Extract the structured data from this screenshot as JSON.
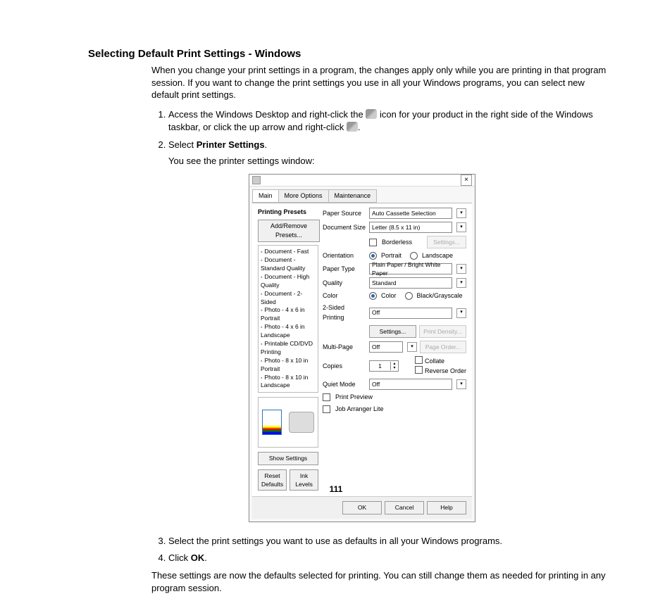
{
  "title": "Selecting Default Print Settings - Windows",
  "intro": "When you change your print settings in a program, the changes apply only while you are printing in that program session. If you want to change the print settings you use in all your Windows programs, you can select new default print settings.",
  "steps": {
    "s1a": "Access the Windows Desktop and right-click the ",
    "s1b": " icon for your product in the right side of the Windows taskbar, or click the up arrow and right-click ",
    "s1c": ".",
    "s2a": "Select ",
    "s2b": "Printer Settings",
    "s2c": ".",
    "s2_sub": "You see the printer settings window:",
    "s3": "Select the print settings you want to use as defaults in all your Windows programs.",
    "s4a": "Click ",
    "s4b": "OK",
    "s4c": "."
  },
  "closing": "These settings are now the defaults selected for printing. You can still change them as needed for printing in any program session.",
  "page_number": "111",
  "dialog": {
    "tabs": {
      "main": "Main",
      "more": "More Options",
      "maint": "Maintenance"
    },
    "presets_header": "Printing Presets",
    "add_remove": "Add/Remove Presets...",
    "presets": [
      "Document - Fast",
      "Document - Standard Quality",
      "Document - High Quality",
      "Document - 2-Sided",
      "Photo - 4 x 6 in Portrait",
      "Photo - 4 x 6 in Landscape",
      "Printable CD/DVD Printing",
      "Photo - 8 x 10 in Portrait",
      "Photo - 8 x 10 in Landscape"
    ],
    "show_settings": "Show Settings",
    "reset_defaults": "Reset Defaults",
    "ink_levels": "Ink Levels",
    "labels": {
      "paper_source": "Paper Source",
      "document_size": "Document Size",
      "borderless": "Borderless",
      "settings": "Settings...",
      "orientation": "Orientation",
      "portrait": "Portrait",
      "landscape": "Landscape",
      "paper_type": "Paper Type",
      "quality": "Quality",
      "color": "Color",
      "color_opt": "Color",
      "bw_opt": "Black/Grayscale",
      "two_sided": "2-Sided Printing",
      "print_density": "Print Density...",
      "multi_page": "Multi-Page",
      "page_order": "Page Order...",
      "copies": "Copies",
      "collate": "Collate",
      "reverse": "Reverse Order",
      "quiet": "Quiet Mode",
      "print_preview": "Print Preview",
      "job_arranger": "Job Arranger Lite"
    },
    "values": {
      "paper_source": "Auto Cassette Selection",
      "document_size": "Letter (8.5 x 11 in)",
      "paper_type": "Plain Paper / Bright White Paper",
      "quality": "Standard",
      "two_sided": "Off",
      "multi_page": "Off",
      "copies": "1",
      "quiet": "Off"
    },
    "footer": {
      "ok": "OK",
      "cancel": "Cancel",
      "help": "Help"
    }
  }
}
